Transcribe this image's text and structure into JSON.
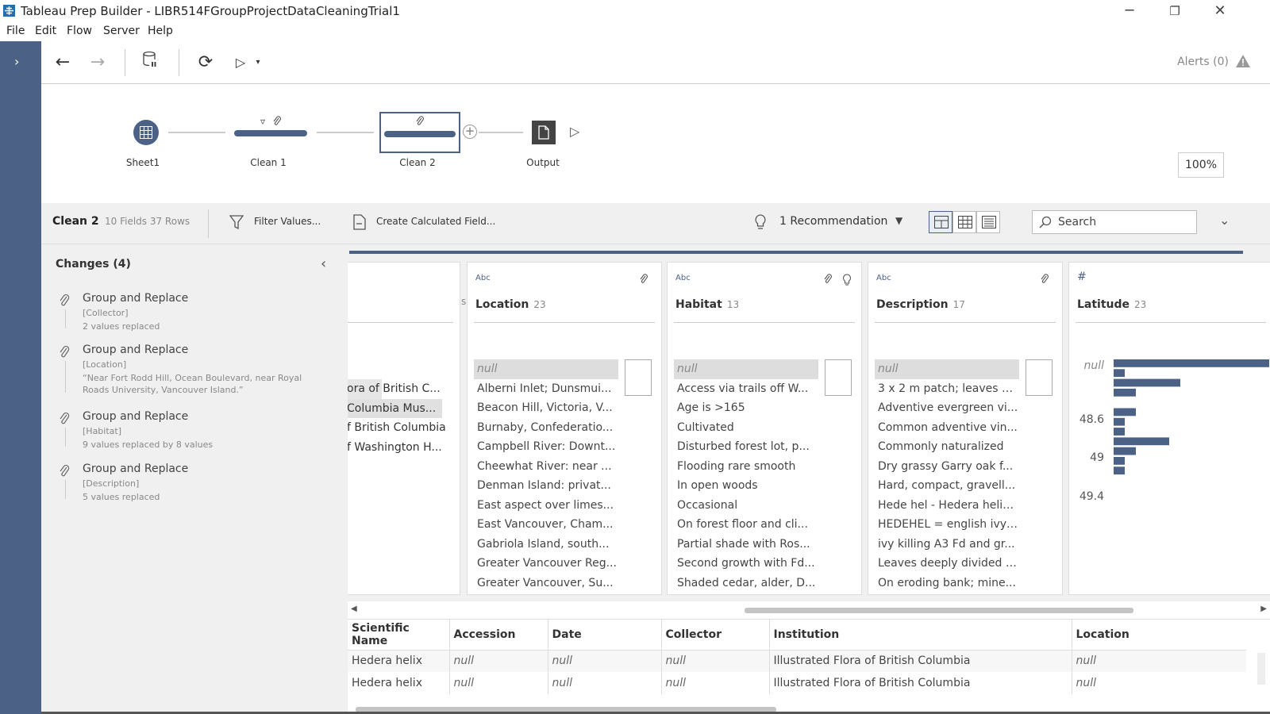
{
  "window": {
    "title": "Tableau Prep Builder - LIBR514FGroupProjectDataCleaningTrial1"
  },
  "menu": [
    "File",
    "Edit",
    "Flow",
    "Server",
    "Help"
  ],
  "toolbar": {
    "alerts": "Alerts (0)"
  },
  "flow": {
    "nodes": [
      {
        "label": "Sheet1"
      },
      {
        "label": "Clean 1"
      },
      {
        "label": "Clean 2"
      },
      {
        "label": "Output"
      }
    ],
    "zoom": "100%"
  },
  "step": {
    "name": "Clean 2",
    "info": "10 Fields  37 Rows",
    "filter_label": "Filter Values...",
    "calc_label": "Create Calculated Field...",
    "recommendation_label": "1 Recommendation",
    "search_placeholder": "Search"
  },
  "changes": {
    "header": "Changes (4)",
    "items": [
      {
        "title": "Group and Replace",
        "field": "[Collector]",
        "detail": "2 values replaced"
      },
      {
        "title": "Group and Replace",
        "field": "[Location]",
        "detail": "“Near Fort Rodd Hill, Ocean Boulevard, near Royal Roads University, Vancouver Island.”"
      },
      {
        "title": "Group and Replace",
        "field": "[Habitat]",
        "detail": "9 values replaced by 8 values"
      },
      {
        "title": "Group and Replace",
        "field": "[Description]",
        "detail": "5 values replaced"
      }
    ]
  },
  "profile": {
    "partial_card": {
      "header_fragment": "s",
      "values": [
        "ora of British C...",
        "Columbia Mus...",
        "f British Columbia",
        "f Washington H..."
      ]
    },
    "cards": [
      {
        "type": "Abc",
        "name": "Location",
        "count": "23",
        "values": [
          "null",
          "Alberni Inlet; Dunsmui...",
          "Beacon Hill, Victoria, V...",
          "Burnaby, Confederatio...",
          "Campbell River: Downt...",
          "Cheewhat River: near ...",
          "Denman Island: privat...",
          "East aspect over limes...",
          "East Vancouver, Cham...",
          "Gabriola Island, south...",
          "Greater Vancouver Reg...",
          "Greater Vancouver, Su..."
        ]
      },
      {
        "type": "Abc",
        "name": "Habitat",
        "count": "13",
        "values": [
          "null",
          "Access via trails off W...",
          "Age is >165",
          "Cultivated",
          "Disturbed forest lot, p...",
          "Flooding rare smooth",
          "In open woods",
          "Occasional",
          "On forest floor and cli...",
          "Partial shade with Ros...",
          "Second growth with Fd...",
          "Shaded cedar, alder, D..."
        ]
      },
      {
        "type": "Abc",
        "name": "Description",
        "count": "17",
        "values": [
          "null",
          "3 x 2 m patch; leaves m...",
          "Adventive evergreen vi...",
          "Common adventive vin...",
          "Commonly naturalized",
          "Dry grassy Garry oak f...",
          "Hard, compact, gravell...",
          "Hede hel - Hedera helix...",
          "HEDEHEL = english ivy;...",
          "ivy killing A3 Fd and gr...",
          "Leaves deeply divided i...",
          "On eroding bank; mine..."
        ]
      },
      {
        "type": "#",
        "name": "Latitude",
        "count": "23",
        "axis_labels": [
          "null",
          "48.6",
          "49",
          "49.4"
        ]
      }
    ]
  },
  "chart_data": {
    "type": "bar",
    "title": "",
    "categories": [
      "null",
      "48.5",
      "48.6",
      "48.7",
      "48.8",
      "48.9",
      "49.0",
      "49.1",
      "49.2",
      "49.3",
      "49.4",
      "49.5"
    ],
    "values": [
      14,
      1,
      6,
      2,
      0,
      2,
      1,
      1,
      5,
      2,
      1,
      1
    ],
    "ytick_labels": [
      "null",
      "48.6",
      "49",
      "49.4"
    ]
  },
  "grid": {
    "columns": [
      "Scientific Name",
      "Accession",
      "Date",
      "Collector",
      "Institution",
      "Location"
    ],
    "rows": [
      [
        "Hedera helix",
        "null",
        "null",
        "null",
        "Illustrated Flora of British Columbia",
        "null"
      ],
      [
        "Hedera helix",
        "null",
        "null",
        "null",
        "Illustrated Flora of British Columbia",
        "null"
      ]
    ]
  },
  "colors": {
    "accent": "#4b6185",
    "panel": "#f0f0f0"
  }
}
